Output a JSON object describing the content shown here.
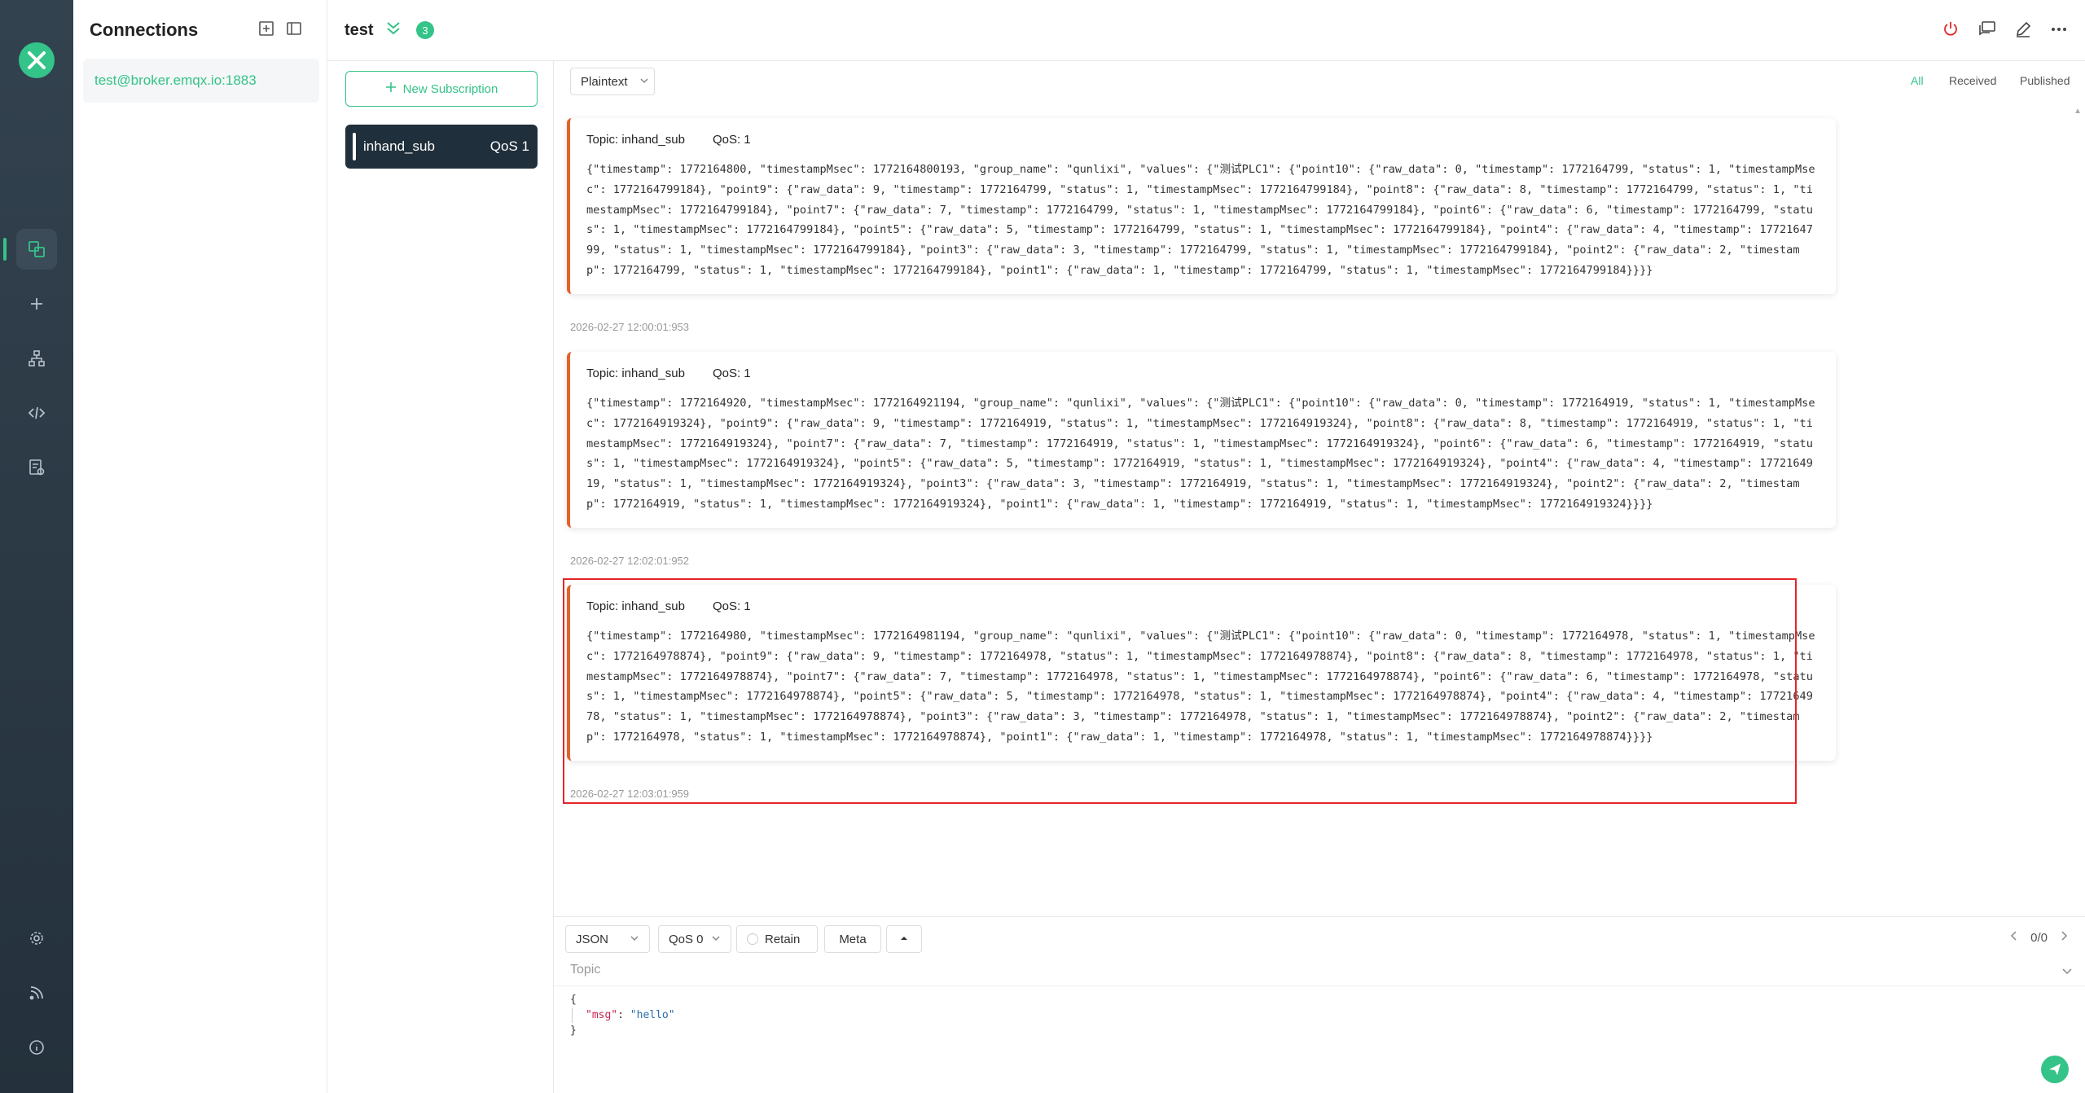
{
  "connections": {
    "title": "Connections",
    "items": [
      {
        "label": "test@broker.emqx.io:1883"
      }
    ]
  },
  "header": {
    "connection_name": "test",
    "badge_count": "3"
  },
  "subscriptions": {
    "new_button": "New Subscription",
    "items": [
      {
        "topic": "inhand_sub",
        "qos": "QoS 1"
      }
    ]
  },
  "message_view": {
    "format": "Plaintext",
    "filters": {
      "all": "All",
      "received": "Received",
      "published": "Published"
    }
  },
  "messages": [
    {
      "topic": "Topic: inhand_sub",
      "qos": "QoS: 1",
      "payload": "{\"timestamp\": 1772164800, \"timestampMsec\": 1772164800193, \"group_name\": \"qunlixi\", \"values\": {\"测试PLC1\": {\"point10\": {\"raw_data\": 0, \"timestamp\": 1772164799, \"status\": 1, \"timestampMsec\": 1772164799184}, \"point9\": {\"raw_data\": 9, \"timestamp\": 1772164799, \"status\": 1, \"timestampMsec\": 1772164799184}, \"point8\": {\"raw_data\": 8, \"timestamp\": 1772164799, \"status\": 1, \"timestampMsec\": 1772164799184}, \"point7\": {\"raw_data\": 7, \"timestamp\": 1772164799, \"status\": 1, \"timestampMsec\": 1772164799184}, \"point6\": {\"raw_data\": 6, \"timestamp\": 1772164799, \"status\": 1, \"timestampMsec\": 1772164799184}, \"point5\": {\"raw_data\": 5, \"timestamp\": 1772164799, \"status\": 1, \"timestampMsec\": 1772164799184}, \"point4\": {\"raw_data\": 4, \"timestamp\": 1772164799, \"status\": 1, \"timestampMsec\": 1772164799184}, \"point3\": {\"raw_data\": 3, \"timestamp\": 1772164799, \"status\": 1, \"timestampMsec\": 1772164799184}, \"point2\": {\"raw_data\": 2, \"timestamp\": 1772164799, \"status\": 1, \"timestampMsec\": 1772164799184}, \"point1\": {\"raw_data\": 1, \"timestamp\": 1772164799, \"status\": 1, \"timestampMsec\": 1772164799184}}}}",
      "time": "2026-02-27 12:00:01:953"
    },
    {
      "topic": "Topic: inhand_sub",
      "qos": "QoS: 1",
      "payload": "{\"timestamp\": 1772164920, \"timestampMsec\": 1772164921194, \"group_name\": \"qunlixi\", \"values\": {\"测试PLC1\": {\"point10\": {\"raw_data\": 0, \"timestamp\": 1772164919, \"status\": 1, \"timestampMsec\": 1772164919324}, \"point9\": {\"raw_data\": 9, \"timestamp\": 1772164919, \"status\": 1, \"timestampMsec\": 1772164919324}, \"point8\": {\"raw_data\": 8, \"timestamp\": 1772164919, \"status\": 1, \"timestampMsec\": 1772164919324}, \"point7\": {\"raw_data\": 7, \"timestamp\": 1772164919, \"status\": 1, \"timestampMsec\": 1772164919324}, \"point6\": {\"raw_data\": 6, \"timestamp\": 1772164919, \"status\": 1, \"timestampMsec\": 1772164919324}, \"point5\": {\"raw_data\": 5, \"timestamp\": 1772164919, \"status\": 1, \"timestampMsec\": 1772164919324}, \"point4\": {\"raw_data\": 4, \"timestamp\": 1772164919, \"status\": 1, \"timestampMsec\": 1772164919324}, \"point3\": {\"raw_data\": 3, \"timestamp\": 1772164919, \"status\": 1, \"timestampMsec\": 1772164919324}, \"point2\": {\"raw_data\": 2, \"timestamp\": 1772164919, \"status\": 1, \"timestampMsec\": 1772164919324}, \"point1\": {\"raw_data\": 1, \"timestamp\": 1772164919, \"status\": 1, \"timestampMsec\": 1772164919324}}}}",
      "time": "2026-02-27 12:02:01:952"
    },
    {
      "topic": "Topic: inhand_sub",
      "qos": "QoS: 1",
      "payload": "{\"timestamp\": 1772164980, \"timestampMsec\": 1772164981194, \"group_name\": \"qunlixi\", \"values\": {\"测试PLC1\": {\"point10\": {\"raw_data\": 0, \"timestamp\": 1772164978, \"status\": 1, \"timestampMsec\": 1772164978874}, \"point9\": {\"raw_data\": 9, \"timestamp\": 1772164978, \"status\": 1, \"timestampMsec\": 1772164978874}, \"point8\": {\"raw_data\": 8, \"timestamp\": 1772164978, \"status\": 1, \"timestampMsec\": 1772164978874}, \"point7\": {\"raw_data\": 7, \"timestamp\": 1772164978, \"status\": 1, \"timestampMsec\": 1772164978874}, \"point6\": {\"raw_data\": 6, \"timestamp\": 1772164978, \"status\": 1, \"timestampMsec\": 1772164978874}, \"point5\": {\"raw_data\": 5, \"timestamp\": 1772164978, \"status\": 1, \"timestampMsec\": 1772164978874}, \"point4\": {\"raw_data\": 4, \"timestamp\": 1772164978, \"status\": 1, \"timestampMsec\": 1772164978874}, \"point3\": {\"raw_data\": 3, \"timestamp\": 1772164978, \"status\": 1, \"timestampMsec\": 1772164978874}, \"point2\": {\"raw_data\": 2, \"timestamp\": 1772164978, \"status\": 1, \"timestampMsec\": 1772164978874}, \"point1\": {\"raw_data\": 1, \"timestamp\": 1772164978, \"status\": 1, \"timestampMsec\": 1772164978874}}}}",
      "time": "2026-02-27 12:03:01:959"
    }
  ],
  "publish": {
    "format": "JSON",
    "qos": "QoS 0",
    "retain_label": "Retain",
    "meta_label": "Meta",
    "pager": "0/0",
    "topic_placeholder": "Topic",
    "payload_open": "{",
    "payload_key": "\"msg\"",
    "payload_sep": ": ",
    "payload_value": "\"hello\"",
    "payload_close": "}"
  },
  "colors": {
    "accent": "#34c388",
    "nav_bg": "#2c3a45",
    "message_bar": "#e2622b",
    "highlight": "#e3262a"
  },
  "icons": [
    "mqttx-logo-icon",
    "connections-icon",
    "plus-icon",
    "network-icon",
    "script-icon",
    "log-icon",
    "settings-icon",
    "feed-icon",
    "info-icon",
    "power-icon",
    "chat-icon",
    "edit-icon",
    "more-icon",
    "send-icon"
  ]
}
